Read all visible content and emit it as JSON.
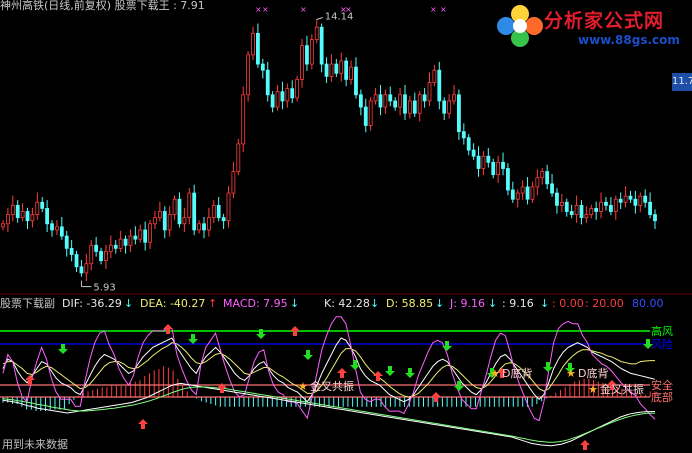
{
  "header": {
    "title": "神州高铁(日线,前复权) 股票下载王 : 7.91"
  },
  "logo": {
    "name": "分析家公式网",
    "url": "www.88gs.com"
  },
  "price_axis": {
    "label": "11.7"
  },
  "indicator": {
    "name": "股票下载副",
    "dif": "DIF: -36.29",
    "dea": "DEA: -40.27",
    "macd": "MACD: 7.95",
    "k": "K: 42.28",
    "d": "D: 58.85",
    "j": "J: 9.16",
    "j2": ": 9.16",
    "v0": ": 0.00",
    "v20": ": 20.00",
    "v80": "80.00"
  },
  "footer": {
    "note": "用到未来数据"
  },
  "colors": {
    "up": "#ff3d3d",
    "down": "#54fcfc",
    "green_line": "#00ff00",
    "blue_line": "#0000ff",
    "pink_line": "#ff60ff",
    "salmon": "#ff7070"
  },
  "chart_data": [
    {
      "type": "candlestick",
      "annotations": [
        {
          "text": "14.14",
          "at": "high"
        },
        {
          "text": "5.93",
          "at": "low"
        }
      ],
      "close": [
        7.6,
        7.9,
        8.2,
        7.8,
        8.0,
        7.7,
        7.9,
        8.3,
        8.1,
        7.6,
        7.4,
        7.5,
        7.2,
        6.8,
        6.6,
        6.2,
        6.0,
        6.3,
        6.9,
        6.7,
        6.4,
        6.7,
        6.9,
        6.8,
        7.1,
        6.9,
        7.2,
        7.1,
        7.4,
        7.0,
        7.6,
        7.8,
        8.0,
        7.4,
        7.9,
        8.4,
        7.6,
        7.8,
        8.6,
        7.4,
        7.6,
        7.4,
        7.8,
        8.2,
        7.8,
        7.7,
        8.6,
        9.3,
        10.2,
        11.8,
        13.1,
        13.8,
        12.8,
        12.6,
        11.8,
        11.4,
        11.9,
        11.6,
        12.0,
        11.7,
        12.3,
        13.4,
        12.8,
        13.6,
        14.0,
        12.8,
        12.4,
        12.8,
        12.5,
        12.9,
        12.3,
        12.7,
        11.8,
        11.4,
        10.8,
        11.6,
        11.8,
        11.4,
        11.8,
        11.6,
        11.4,
        11.8,
        11.2,
        11.6,
        11.2,
        11.8,
        11.6,
        12.2,
        12.6,
        11.6,
        11.2,
        11.6,
        11.8,
        10.6,
        10.4,
        10.0,
        9.8,
        9.4,
        9.8,
        9.6,
        9.2,
        9.6,
        9.4,
        8.7,
        8.4,
        8.6,
        8.8,
        8.4,
        8.8,
        9.1,
        9.3,
        8.9,
        8.6,
        8.2,
        8.3,
        8.0,
        7.9,
        8.2,
        7.8,
        7.9,
        8.1,
        8.0,
        8.3,
        8.2,
        8.0,
        8.4,
        8.3,
        8.5,
        8.4,
        8.2,
        8.5,
        8.3,
        7.9,
        7.7
      ]
    },
    {
      "type": "line",
      "title": "股票下载副",
      "ylim": [
        0,
        100
      ],
      "reference_lines": [
        {
          "name": "高风",
          "value": 80
        },
        {
          "name": "风险",
          "value": 70
        },
        {
          "name": "安全",
          "value": 20
        },
        {
          "name": "底部",
          "value": 10
        }
      ],
      "labels": [
        "金叉共振",
        "D底背",
        "D底背",
        "金叉共振"
      ],
      "series": [
        {
          "name": "K",
          "values": [
            52,
            60,
            58,
            50,
            44,
            40,
            46,
            52,
            58,
            56,
            50,
            44,
            40,
            38,
            36,
            32,
            30,
            38,
            46,
            54,
            60,
            64,
            62,
            60,
            56,
            52,
            48,
            50,
            56,
            62,
            66,
            70,
            72,
            74,
            76,
            78,
            70,
            64,
            58,
            52,
            48,
            56,
            62,
            66,
            70,
            66,
            60,
            54,
            48,
            44,
            42,
            46,
            52,
            56,
            58,
            52,
            46,
            42,
            40,
            36,
            34,
            32,
            28,
            24,
            30,
            38,
            48,
            56,
            64,
            72,
            78,
            76,
            70,
            62,
            52,
            46,
            42,
            40,
            38,
            34,
            30,
            28,
            26,
            24,
            26,
            30,
            36,
            42,
            48,
            54,
            58,
            60,
            58,
            52,
            46,
            40,
            36,
            32,
            30,
            34,
            40,
            48,
            56,
            62,
            64,
            60,
            54,
            48,
            42,
            36,
            30,
            26,
            30,
            40,
            52,
            60,
            66,
            70,
            72,
            74,
            72,
            70,
            66,
            64,
            62,
            60,
            58,
            55,
            52,
            50,
            48,
            47,
            46,
            45,
            44,
            43
          ]
        },
        {
          "name": "D",
          "values": [
            56,
            58,
            58,
            55,
            52,
            48,
            47,
            49,
            52,
            54,
            53,
            50,
            47,
            44,
            41,
            38,
            35,
            36,
            39,
            44,
            49,
            54,
            57,
            58,
            58,
            56,
            53,
            52,
            53,
            56,
            59,
            63,
            66,
            69,
            71,
            74,
            73,
            70,
            66,
            61,
            57,
            56,
            58,
            61,
            64,
            65,
            63,
            60,
            56,
            52,
            48,
            47,
            49,
            51,
            53,
            53,
            50,
            47,
            45,
            42,
            39,
            37,
            34,
            31,
            31,
            33,
            38,
            44,
            51,
            58,
            65,
            69,
            69,
            67,
            62,
            56,
            51,
            47,
            44,
            41,
            37,
            34,
            31,
            29,
            28,
            29,
            31,
            35,
            39,
            44,
            49,
            53,
            55,
            54,
            51,
            47,
            43,
            39,
            36,
            35,
            37,
            41,
            46,
            52,
            56,
            57,
            56,
            53,
            49,
            45,
            40,
            35,
            33,
            35,
            41,
            47,
            54,
            59,
            63,
            66,
            68,
            68,
            67,
            66,
            65,
            63,
            62,
            60,
            58,
            57,
            56,
            56,
            58,
            58.5,
            58.8,
            58.85
          ]
        },
        {
          "name": "J",
          "values": [
            48,
            64,
            58,
            40,
            28,
            24,
            44,
            58,
            70,
            60,
            44,
            32,
            26,
            26,
            26,
            20,
            20,
            42,
            60,
            74,
            82,
            84,
            72,
            64,
            52,
            44,
            38,
            46,
            62,
            74,
            80,
            84,
            84,
            84,
            86,
            86,
            64,
            52,
            42,
            34,
            30,
            56,
            70,
            76,
            82,
            68,
            54,
            42,
            32,
            28,
            30,
            44,
            58,
            66,
            68,
            50,
            38,
            32,
            30,
            24,
            24,
            22,
            16,
            10,
            28,
            48,
            68,
            80,
            90,
            96,
            96,
            90,
            72,
            52,
            32,
            26,
            24,
            26,
            26,
            20,
            16,
            16,
            16,
            14,
            22,
            32,
            46,
            56,
            66,
            74,
            76,
            74,
            64,
            48,
            36,
            26,
            22,
            18,
            18,
            32,
            46,
            62,
            76,
            82,
            80,
            66,
            50,
            38,
            28,
            18,
            10,
            8,
            24,
            50,
            74,
            86,
            90,
            92,
            90,
            90,
            80,
            74,
            64,
            60,
            56,
            54,
            50,
            45,
            40,
            36,
            32,
            29,
            22,
            18,
            13,
            9.16
          ]
        },
        {
          "name": "DIF",
          "values": [
            -8,
            -10,
            -12,
            -14,
            -18,
            -22,
            -24,
            -28,
            -30,
            -32,
            -34,
            -36,
            -38,
            -40,
            -38,
            -36,
            -34,
            -32,
            -30,
            -28,
            -26,
            -24,
            -22,
            -20,
            -18,
            -16,
            -14,
            -10,
            -6,
            -2,
            4,
            10,
            16,
            22,
            28,
            32,
            34,
            32,
            30,
            28,
            26,
            24,
            22,
            20,
            18,
            16,
            14,
            12,
            10,
            8,
            6,
            4,
            2,
            0,
            -2,
            -4,
            -6,
            -8,
            -10,
            -12,
            -14,
            -16,
            -18,
            -20,
            -22,
            -24,
            -26,
            -28,
            -30,
            -32,
            -34,
            -36,
            -38,
            -40,
            -42,
            -44,
            -46,
            -48,
            -50,
            -52,
            -54,
            -56,
            -58,
            -60,
            -62,
            -64,
            -66,
            -68,
            -70,
            -72,
            -74,
            -76,
            -78,
            -80,
            -82,
            -84,
            -86,
            -88,
            -90,
            -92,
            -94,
            -96,
            -98,
            -100,
            -104,
            -108,
            -112,
            -116,
            -118,
            -120,
            -121,
            -122,
            -120,
            -118,
            -114,
            -110,
            -104,
            -98,
            -92,
            -86,
            -80,
            -74,
            -68,
            -62,
            -56,
            -50,
            -46,
            -42,
            -40,
            -38,
            -37,
            -36.5,
            -36.29
          ]
        },
        {
          "name": "DEA",
          "values": [
            -4,
            -6,
            -7,
            -9,
            -11,
            -13,
            -15,
            -18,
            -20,
            -22,
            -25,
            -27,
            -29,
            -31,
            -33,
            -34,
            -35,
            -35,
            -34,
            -33,
            -32,
            -31,
            -29,
            -28,
            -26,
            -24,
            -22,
            -20,
            -17,
            -14,
            -11,
            -7,
            -3,
            2,
            6,
            11,
            15,
            19,
            22,
            24,
            25,
            25,
            25,
            24,
            23,
            22,
            21,
            19,
            17,
            15,
            13,
            11,
            9,
            7,
            5,
            3,
            1,
            -1,
            -3,
            -5,
            -7,
            -9,
            -11,
            -13,
            -15,
            -17,
            -19,
            -21,
            -23,
            -25,
            -27,
            -29,
            -31,
            -33,
            -35,
            -37,
            -39,
            -41,
            -43,
            -45,
            -47,
            -49,
            -51,
            -53,
            -55,
            -57,
            -59,
            -61,
            -63,
            -65,
            -67,
            -69,
            -71,
            -73,
            -75,
            -77,
            -79,
            -81,
            -83,
            -85,
            -87,
            -89,
            -91,
            -93,
            -95,
            -97,
            -99,
            -102,
            -104,
            -107,
            -109,
            -111,
            -112,
            -113,
            -113,
            -112,
            -110,
            -107,
            -103,
            -99,
            -94,
            -89,
            -84,
            -79,
            -74,
            -69,
            -64,
            -59,
            -55,
            -51,
            -48,
            -45,
            -43,
            -41,
            -40.5,
            -40.27
          ]
        },
        {
          "name": "MACD",
          "values": [
            -8,
            -8,
            -10,
            -10,
            -14,
            -18,
            -18,
            -20,
            -20,
            -20,
            -18,
            -18,
            -18,
            -18,
            -10,
            -4,
            2,
            6,
            8,
            10,
            12,
            14,
            14,
            16,
            16,
            16,
            16,
            20,
            22,
            24,
            30,
            34,
            38,
            40,
            44,
            42,
            38,
            26,
            16,
            8,
            2,
            -2,
            -6,
            -8,
            -10,
            -12,
            -14,
            -14,
            -14,
            -14,
            -14,
            -14,
            -14,
            -14,
            -14,
            -14,
            -14,
            -14,
            -14,
            -14,
            -14,
            -14,
            -14,
            -14,
            -14,
            -14,
            -14,
            -14,
            -14,
            -14,
            -14,
            -14,
            -14,
            -14,
            -14,
            -14,
            -14,
            -14,
            -14,
            -14,
            -14,
            -14,
            -14,
            -14,
            -14,
            -14,
            -14,
            -14,
            -14,
            -14,
            -14,
            -14,
            -14,
            -14,
            -14,
            -14,
            -14,
            -14,
            -14,
            -14,
            -14,
            -14,
            -14,
            -14,
            -14,
            -14,
            -14,
            -14,
            -14,
            -14,
            -14,
            -14,
            -14,
            -10,
            -6,
            -2,
            2,
            6,
            10,
            14,
            18,
            22,
            24,
            26,
            26,
            24,
            22,
            20,
            18,
            16,
            14,
            12,
            10,
            8,
            6,
            4,
            3,
            8,
            7.95
          ]
        }
      ]
    }
  ]
}
